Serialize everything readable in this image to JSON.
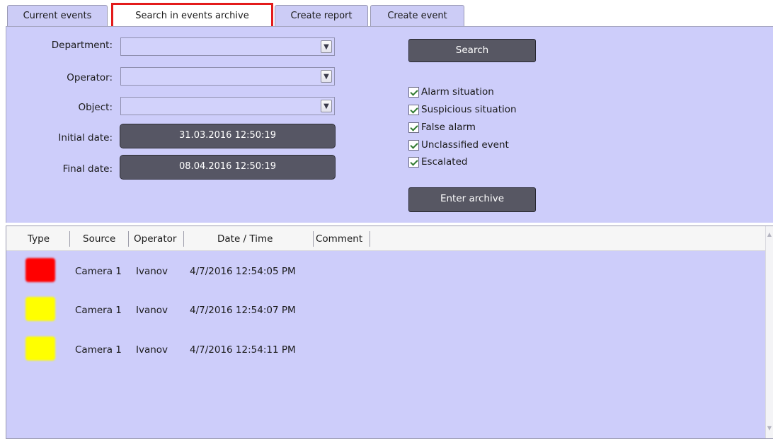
{
  "tabs": [
    {
      "label": "Current events",
      "active": false
    },
    {
      "label": "Search in events archive",
      "active": true
    },
    {
      "label": "Create report",
      "active": false
    },
    {
      "label": "Create event",
      "active": false
    }
  ],
  "filters": {
    "department_label": "Department:",
    "operator_label": "Operator:",
    "object_label": "Object:",
    "initial_date_label": "Initial date:",
    "initial_date_value": "31.03.2016 12:50:19",
    "final_date_label": "Final date:",
    "final_date_value": "08.04.2016 12:50:19"
  },
  "actions": {
    "search_label": "Search",
    "enter_archive_label": "Enter archive"
  },
  "event_types": [
    {
      "label": "Alarm situation",
      "checked": true
    },
    {
      "label": "Suspicious situation",
      "checked": true
    },
    {
      "label": "False alarm",
      "checked": true
    },
    {
      "label": "Unclassified event",
      "checked": true
    },
    {
      "label": "Escalated",
      "checked": true
    }
  ],
  "table": {
    "columns": [
      "Type",
      "Source",
      "Operator",
      "Date / Time",
      "Comment"
    ],
    "rows": [
      {
        "type_color": "#ff0000",
        "source": "Camera 1",
        "operator": "Ivanov",
        "datetime": "4/7/2016 12:54:05 PM",
        "comment": ""
      },
      {
        "type_color": "#ffff00",
        "source": "Camera 1",
        "operator": "Ivanov",
        "datetime": "4/7/2016 12:54:07 PM",
        "comment": ""
      },
      {
        "type_color": "#ffff00",
        "source": "Camera 1",
        "operator": "Ivanov",
        "datetime": "4/7/2016 12:54:11 PM",
        "comment": ""
      }
    ]
  },
  "colors": {
    "panel_bg": "#cdcdfa",
    "button_bg": "#575763",
    "highlight": "#e31b1b",
    "alarm": "#ff0000",
    "suspicious": "#ffff00"
  }
}
